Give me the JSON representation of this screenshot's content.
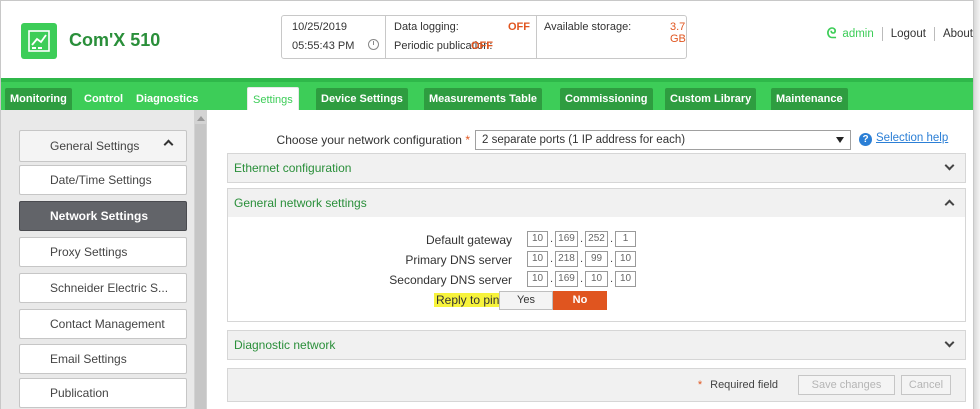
{
  "app": {
    "title": "Com'X 510",
    "logo_icon": "building-network-icon"
  },
  "status": {
    "date": "10/25/2019",
    "time": "05:55:43 PM",
    "data_logging_label": "Data logging:",
    "data_logging_value": "OFF",
    "periodic_publication_label": "Periodic publication:",
    "periodic_publication_value": "OFF",
    "available_storage_label": "Available storage:",
    "available_storage_value": "3.7 GB"
  },
  "user": {
    "name": "admin",
    "logout": "Logout",
    "about": "About"
  },
  "tabs": [
    {
      "label": "Monitoring"
    },
    {
      "label": "Control"
    },
    {
      "label": "Diagnostics"
    },
    {
      "label": "Settings",
      "active": true
    },
    {
      "label": "Device Settings"
    },
    {
      "label": "Measurements Table"
    },
    {
      "label": "Commissioning"
    },
    {
      "label": "Custom Library"
    },
    {
      "label": "Maintenance"
    }
  ],
  "sidebar": {
    "group": "General Settings",
    "items": [
      {
        "label": "Date/Time Settings"
      },
      {
        "label": "Network Settings",
        "active": true
      },
      {
        "label": "Proxy Settings"
      },
      {
        "label": "Schneider Electric S..."
      },
      {
        "label": "Contact Management"
      },
      {
        "label": "Email Settings"
      },
      {
        "label": "Publication"
      }
    ]
  },
  "main": {
    "network_config_label": "Choose your network configuration",
    "network_config_value": "2 separate ports (1 IP address for each)",
    "selection_help": "Selection help",
    "panels": {
      "ethernet": "Ethernet configuration",
      "general": "General network settings",
      "diagnostic": "Diagnostic network"
    },
    "default_gateway_label": "Default gateway",
    "default_gateway": [
      "10",
      "169",
      "252",
      "1"
    ],
    "primary_dns_label": "Primary DNS server",
    "primary_dns": [
      "10",
      "218",
      "99",
      "10"
    ],
    "secondary_dns_label": "Secondary DNS server",
    "secondary_dns": [
      "10",
      "169",
      "10",
      "10"
    ],
    "reply_to_ping_label": "Reply to ping",
    "reply_yes": "Yes",
    "reply_no": "No",
    "reply_selected": "No",
    "required_field": "Required field",
    "save_changes": "Save changes",
    "cancel": "Cancel"
  },
  "colors": {
    "brand_green": "#3dcd58",
    "accent_orange": "#e0551f",
    "active_sidebar": "#626469",
    "link_blue": "#2b7fd6",
    "highlight_yellow": "#f7f33c"
  }
}
